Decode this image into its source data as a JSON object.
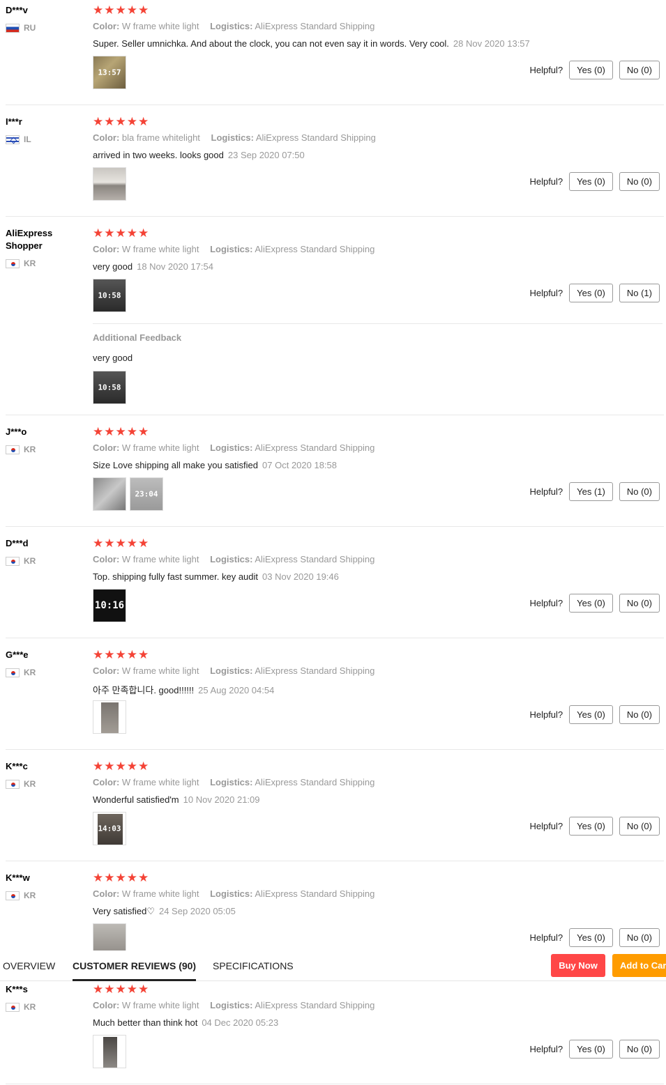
{
  "reviews": [
    {
      "user": "D***v",
      "country": "RU",
      "color_label": "Color:",
      "color": "W frame white light",
      "logistics_label": "Logistics:",
      "logistics": "AliExpress Standard Shipping",
      "text": "Super. Seller umnichka. And about the clock, you can not even say it in words. Very cool.",
      "date": "28 Nov 2020 13:57",
      "helpful_label": "Helpful?",
      "yes": "Yes (0)",
      "no": "No (0)",
      "photos": [
        "clock photo"
      ]
    },
    {
      "user": "I***r",
      "country": "IL",
      "color_label": "Color:",
      "color": "bla frame whitelight",
      "logistics_label": "Logistics:",
      "logistics": "AliExpress Standard Shipping",
      "text": "arrived in two weeks. looks good",
      "date": "23 Sep 2020 07:50",
      "helpful_label": "Helpful?",
      "yes": "Yes (0)",
      "no": "No (0)",
      "photos": [
        "room photo"
      ]
    },
    {
      "user": "AliExpress Shopper",
      "country": "KR",
      "color_label": "Color:",
      "color": "W frame white light",
      "logistics_label": "Logistics:",
      "logistics": "AliExpress Standard Shipping",
      "text": "very good",
      "date": "18 Nov 2020 17:54",
      "helpful_label": "Helpful?",
      "yes": "Yes (0)",
      "no": "No (1)",
      "photos": [
        "clock photo"
      ],
      "additional": {
        "title": "Additional Feedback",
        "text": "very good"
      }
    },
    {
      "user": "J***o",
      "country": "KR",
      "color_label": "Color:",
      "color": "W frame white light",
      "logistics_label": "Logistics:",
      "logistics": "AliExpress Standard Shipping",
      "text": "Size Love shipping all make you satisfied",
      "date": "07 Oct 2020 18:58",
      "helpful_label": "Helpful?",
      "yes": "Yes (1)",
      "no": "No (0)",
      "photos": [
        "wall photo",
        "clock photo"
      ]
    },
    {
      "user": "D***d",
      "country": "KR",
      "color_label": "Color:",
      "color": "W frame white light",
      "logistics_label": "Logistics:",
      "logistics": "AliExpress Standard Shipping",
      "text": "Top. shipping fully fast summer. key audit",
      "date": "03 Nov 2020 19:46",
      "helpful_label": "Helpful?",
      "yes": "Yes (0)",
      "no": "No (0)",
      "photos": [
        "clock photo"
      ]
    },
    {
      "user": "G***e",
      "country": "KR",
      "color_label": "Color:",
      "color": "W frame white light",
      "logistics_label": "Logistics:",
      "logistics": "AliExpress Standard Shipping",
      "text": "아주 만족합니다. good!!!!!!",
      "date": "25 Aug 2020 04:54",
      "helpful_label": "Helpful?",
      "yes": "Yes (0)",
      "no": "No (0)",
      "photos": [
        "clock photo"
      ]
    },
    {
      "user": "K***c",
      "country": "KR",
      "color_label": "Color:",
      "color": "W frame white light",
      "logistics_label": "Logistics:",
      "logistics": "AliExpress Standard Shipping",
      "text": "Wonderful satisfied'm",
      "date": "10 Nov 2020 21:09",
      "helpful_label": "Helpful?",
      "yes": "Yes (0)",
      "no": "No (0)",
      "photos": [
        "clock photo"
      ]
    },
    {
      "user": "K***w",
      "country": "KR",
      "color_label": "Color:",
      "color": "W frame white light",
      "logistics_label": "Logistics:",
      "logistics": "AliExpress Standard Shipping",
      "text": "Very satisfied♡",
      "date": "24 Sep 2020 05:05",
      "helpful_label": "Helpful?",
      "yes": "Yes (0)",
      "no": "No (0)",
      "photos": [
        "clock photo"
      ]
    },
    {
      "user": "K***s",
      "country": "KR",
      "color_label": "Color:",
      "color": "W frame white light",
      "logistics_label": "Logistics:",
      "logistics": "AliExpress Standard Shipping",
      "text": "Much better than think hot",
      "date": "04 Dec 2020 05:23",
      "helpful_label": "Helpful?",
      "yes": "Yes (0)",
      "no": "No (0)",
      "photos": [
        "clock photo"
      ]
    }
  ],
  "thumb_digits": {
    "r0": "13:57",
    "r2": "10:58",
    "r2b": "10:58",
    "r3b": "23:04",
    "r4": "10:16",
    "r6": "14:03"
  },
  "tabs": {
    "overview": "OVERVIEW",
    "reviews": "CUSTOMER REVIEWS (90)",
    "specs": "SPECIFICATIONS"
  },
  "actions": {
    "buy": "Buy Now",
    "cart": "Add to Cart"
  },
  "colors": {
    "star": "#f44336",
    "buy": "#ff4747",
    "cart": "#ff9c00"
  },
  "icons": {
    "star": "star-icon",
    "flag_ru": "flag-ru-icon",
    "flag_il": "flag-il-icon",
    "flag_kr": "flag-kr-icon"
  }
}
